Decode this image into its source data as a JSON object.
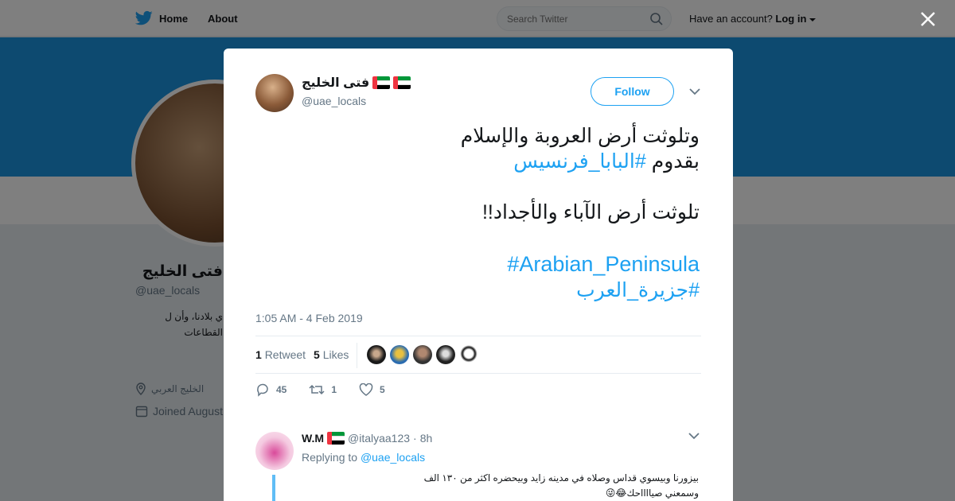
{
  "nav": {
    "home_label": "Home",
    "about_label": "About",
    "search_placeholder": "Search Twitter",
    "have_account": "Have an account?",
    "login_label": "Log in"
  },
  "profile": {
    "name": "فتى الخليج",
    "handle": "@uae_locals",
    "bio": "ي بلادنا، وأن ل القطاعات",
    "location": "الخليج العربي",
    "joined": "Joined August"
  },
  "tweet": {
    "author_name": "فتى الخليج",
    "handle": "@uae_locals",
    "follow_label": "Follow",
    "line1": "وتلوثت أرض العروبة والإسلام",
    "line2_prefix": "بقدوم ",
    "line2_hashtag": "#البابا_فرنسيس",
    "line3": "تلوثت أرض الآباء والأجداد!!",
    "hashtag_en": "#Arabian_Peninsula",
    "hashtag_ar": "#جزيرة_العرب",
    "timestamp": "1:05 AM - 4 Feb 2019",
    "retweet_count": "1",
    "retweet_label": "Retweet",
    "likes_count": "5",
    "likes_label": "Likes",
    "reply_count": "45",
    "action_retweet_count": "1",
    "action_like_count": "5"
  },
  "reply": {
    "name": "W.M",
    "handle": "@italyaa123",
    "separator": "·",
    "time": "8h",
    "replying_label": "Replying to",
    "replying_to": "@uae_locals",
    "text_line1": "بيزورنا وبيسوي قداس وصلاه في مدينه زايد وبيحضره اكثر من ١٣٠ الف",
    "text_line2": "وسمعني صيااااحك😂😜"
  },
  "colors": {
    "accent": "#1da1f2",
    "banner": "#1b95e0",
    "muted": "#657786"
  }
}
